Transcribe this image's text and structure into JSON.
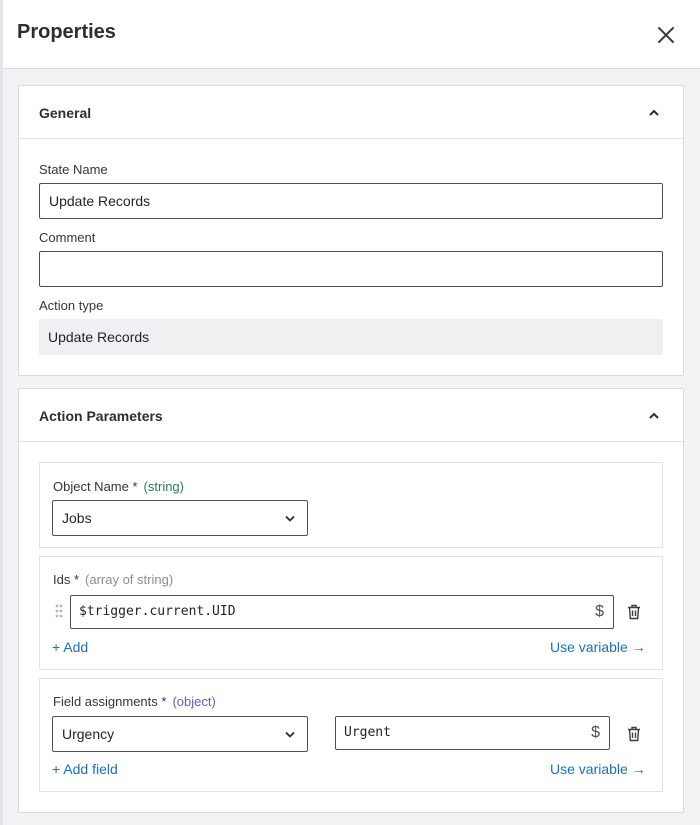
{
  "header": {
    "title": "Properties"
  },
  "general": {
    "title": "General",
    "state_name_label": "State Name",
    "state_name_value": "Update Records",
    "comment_label": "Comment",
    "comment_value": "",
    "action_type_label": "Action type",
    "action_type_value": "Update Records"
  },
  "action_parameters": {
    "title": "Action Parameters",
    "object_name": {
      "label": "Object Name *",
      "type": "(string)",
      "value": "Jobs"
    },
    "ids": {
      "label": "Ids *",
      "type": "(array of string)",
      "value": "$trigger.current.UID",
      "dollar": "$",
      "add_label": "+ Add",
      "use_variable_label": "Use variable →"
    },
    "field_assignments": {
      "label": "Field assignments *",
      "type": "(object)",
      "field": "Urgency",
      "value": "Urgent",
      "dollar": "$",
      "add_label": "+ Add field",
      "use_variable_label": "Use variable →"
    }
  },
  "colors": {
    "link": "#1f6fb5",
    "type_string": "#2e7d4f",
    "type_object": "#6b5bb5"
  },
  "icons": [
    "close-icon",
    "caret-up-icon",
    "chevron-down-icon",
    "drag-handle-icon",
    "trash-icon"
  ]
}
